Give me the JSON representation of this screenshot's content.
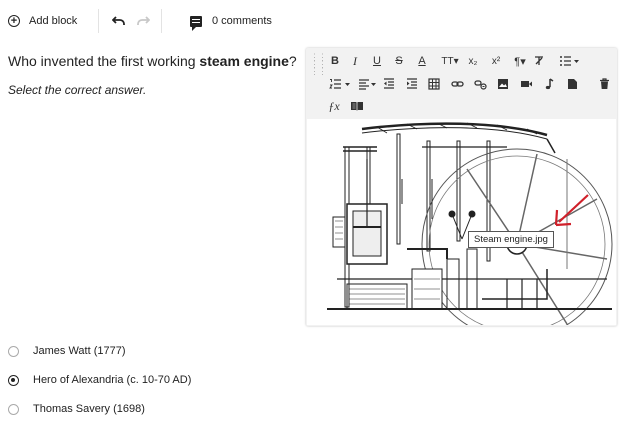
{
  "toolbar": {
    "add_block_label": "Add block",
    "comments_label": "0 comments"
  },
  "question": {
    "prefix": "Who invented the first working ",
    "bold": "steam engine",
    "suffix": "?"
  },
  "instruction": "Select the correct answer.",
  "editor": {
    "image_tooltip": "Steam engine.jpg",
    "buttons": [
      {
        "name": "bold-button",
        "glyph": "B"
      },
      {
        "name": "italic-button",
        "glyph": "I"
      },
      {
        "name": "underline-button",
        "glyph": "U"
      },
      {
        "name": "strikethrough-button",
        "glyph": "S"
      },
      {
        "name": "font-color-button",
        "glyph": "A"
      },
      {
        "name": "font-size-button",
        "glyph": "TT"
      },
      {
        "name": "subscript-button",
        "glyph": "X₂"
      },
      {
        "name": "superscript-button",
        "glyph": "X²"
      },
      {
        "name": "paragraph-format-button",
        "glyph": "¶"
      },
      {
        "name": "clear-format-button",
        "glyph": "T"
      },
      {
        "name": "unordered-list-button",
        "glyph": "☰"
      }
    ]
  },
  "answers": [
    {
      "label": "James Watt (1777)",
      "selected": false
    },
    {
      "label": "Hero of Alexandria (c. 10-70 AD)",
      "selected": true
    },
    {
      "label": "Thomas Savery (1698)",
      "selected": false
    }
  ],
  "colors": {
    "arrow": "#d0202a",
    "editor_bg": "#f2f2f2"
  }
}
